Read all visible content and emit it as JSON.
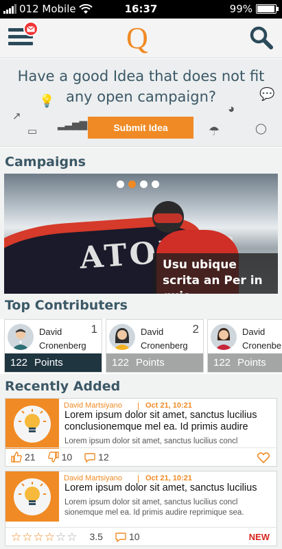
{
  "status_bar": {
    "carrier": "012 Mobile",
    "time": "16:37",
    "battery": "99%"
  },
  "header": {
    "logo": "Q"
  },
  "idea_banner": {
    "title": "Have a good Idea that does not fit any open campaign?",
    "submit_label": "Submit Idea"
  },
  "campaigns": {
    "title": "Campaigns",
    "slide_count": 4,
    "active_slide": 2,
    "caption": "Usu ubique scrita an Per in quis",
    "board_text": "ATOMIC"
  },
  "contributors": {
    "title": "Top Contributers",
    "items": [
      {
        "first": "David",
        "last": "Cronenberg",
        "rank": "1",
        "points": "122",
        "points_label": "Points",
        "bar_color": "#1f3540"
      },
      {
        "first": "David",
        "last": "Cronenberg",
        "rank": "2",
        "points": "122",
        "points_label": "Points",
        "bar_color": "#a4a6a6"
      },
      {
        "first": "David",
        "last": "Cronenberg",
        "rank": "",
        "points": "122",
        "points_label": "Points",
        "bar_color": "#a4a6a6"
      }
    ]
  },
  "recent": {
    "title": "Recently Added",
    "items": [
      {
        "author": "David Martsiyano",
        "separator": "|",
        "date": "Oct 21, 10:21",
        "headline": "Lorem ipsum dolor sit amet, sanctus lucilius conclusionemque mel ea. Id primis audire",
        "body": "Lorem ipsum dolor sit amet, sanctus lucilius concl",
        "likes": "21",
        "dislikes": "10",
        "comments": "12"
      },
      {
        "author": "David Martsiyano",
        "separator": "|",
        "date": "Oct 21, 10:21",
        "headline": "Lorem ipsum dolor sit amet, sanctus lucilius",
        "body": "Lorem ipsum dolor sit amet, sanctus lucilius concl sionemque mel ea. Id primis audire reprimique sea.",
        "rating": "3.5",
        "rating_value": 3.5,
        "comments": "10",
        "badge": "NEW"
      }
    ]
  },
  "colors": {
    "accent": "#f08a24",
    "heading": "#3b5866",
    "new_badge": "#d7261e"
  }
}
